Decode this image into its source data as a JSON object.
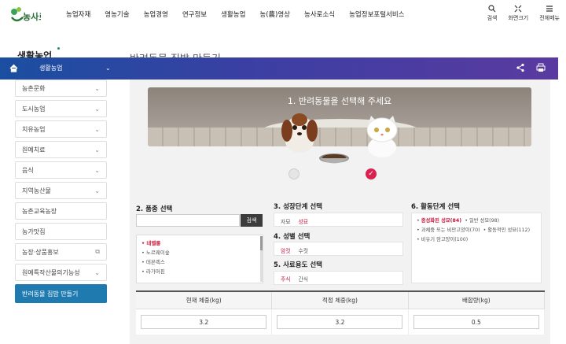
{
  "header": {
    "logo_alt": "농사로",
    "nav": [
      "농업자재",
      "영농기술",
      "농업경영",
      "연구정보",
      "생활농업",
      "농(農)영상",
      "농사로소식",
      "농업정보포털서비스"
    ],
    "util": [
      {
        "label": "검색",
        "icon": "search-icon"
      },
      {
        "label": "화면크기",
        "icon": "expand-icon"
      },
      {
        "label": "전체메뉴",
        "icon": "menu-icon"
      }
    ]
  },
  "left_title": "생활농업",
  "page_title": "반려동물 집밥 만들기",
  "location": {
    "home_icon": "home-icon",
    "current": "생활농업",
    "share_icon": "share-icon",
    "print_icon": "print-icon"
  },
  "sidebar": {
    "items": [
      {
        "label": "농촌문화",
        "icon": "chevron-down-icon"
      },
      {
        "label": "도시농업",
        "icon": "chevron-down-icon"
      },
      {
        "label": "치유농업",
        "icon": "chevron-down-icon"
      },
      {
        "label": "원예치료",
        "icon": "chevron-down-icon"
      },
      {
        "label": "음식",
        "icon": "chevron-down-icon"
      },
      {
        "label": "지역농산물",
        "icon": "chevron-down-icon"
      },
      {
        "label": "농촌교육농장",
        "icon": ""
      },
      {
        "label": "농가맛집",
        "icon": ""
      },
      {
        "label": "농장·상품홍보",
        "icon": "external-link-icon"
      },
      {
        "label": "원예특작산물의기능성",
        "icon": "chevron-down-icon"
      },
      {
        "label": "반려동물 집밥 만들기",
        "icon": ""
      }
    ]
  },
  "banner": {
    "prompt": "1. 반려동물을 선택해 주세요",
    "selected": "cat"
  },
  "breed": {
    "title": "2. 품종 선택",
    "search_btn": "검색",
    "search_placeholder": "",
    "list": [
      "네벨룽",
      "노르웨이숲",
      "데본렉스",
      "라가머핀"
    ],
    "selected_index": 0
  },
  "growth": {
    "title": "3. 성장단계 선택",
    "options": [
      "자묘",
      "성묘"
    ],
    "selected": "성묘"
  },
  "sex": {
    "title": "4. 성별 선택",
    "options": [
      "암컷",
      "수컷"
    ],
    "selected": "암컷"
  },
  "feed": {
    "title": "5. 사료용도 선택",
    "options": [
      "주식",
      "간식"
    ],
    "selected": "주식"
  },
  "activity": {
    "title": "6. 활동단계 선택",
    "rows": [
      [
        "중성화된 성묘(84)",
        "일반 성묘(98)"
      ],
      [
        "과체중 또는 비만고양이(70)",
        "활동적인 성묘(112)"
      ],
      [
        "비유기 암고양이(100)"
      ]
    ],
    "selected": "중성화된 성묘(84)"
  },
  "result": {
    "headers": [
      "현재 체중(kg)",
      "적정 체중(kg)",
      "배합량(kg)"
    ],
    "values": [
      "3.2",
      "3.2",
      "0.5"
    ]
  }
}
